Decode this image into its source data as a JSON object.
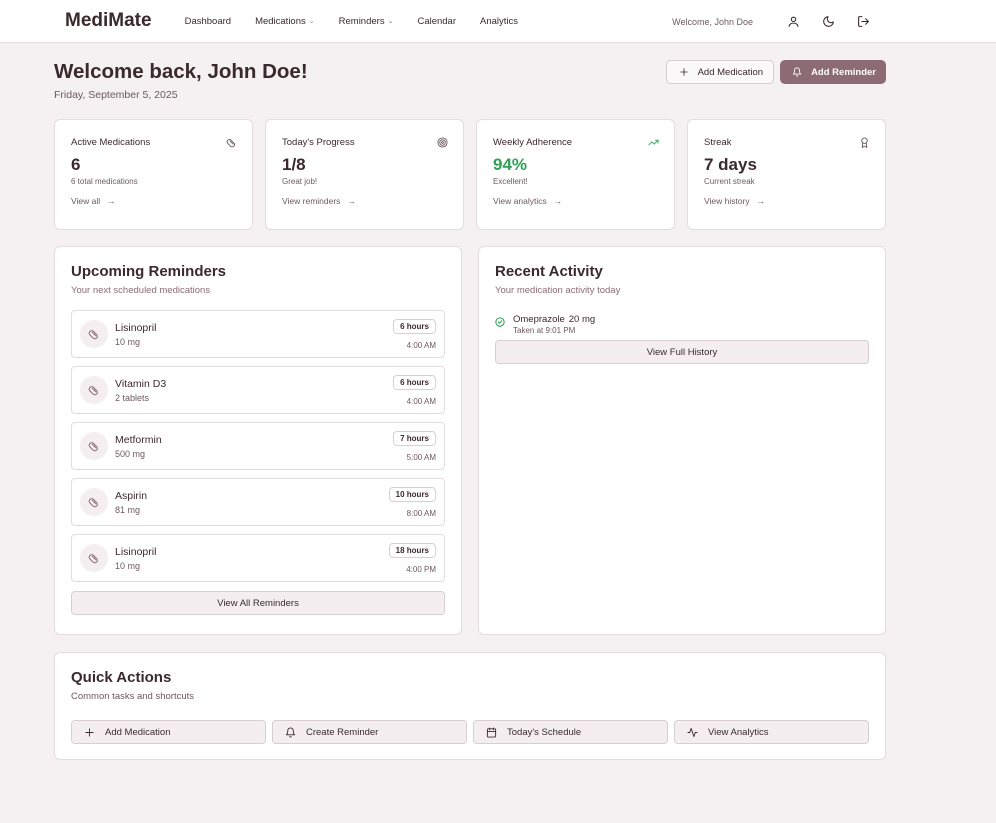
{
  "brand": "MediMate",
  "nav": [
    {
      "label": "Dashboard"
    },
    {
      "label": "Medications"
    },
    {
      "label": "Reminders"
    },
    {
      "label": "Calendar"
    },
    {
      "label": "Analytics"
    }
  ],
  "user": {
    "welcome": "Welcome, John Doe"
  },
  "header": {
    "title": "Welcome back, John Doe!",
    "date": "Friday, September 5, 2025",
    "add_medication": "Add Medication",
    "add_reminder": "Add Reminder"
  },
  "stats": [
    {
      "label": "Active Medications",
      "value": "6",
      "sub": "6 total medications",
      "link": "View all",
      "icon": "pill-icon"
    },
    {
      "label": "Today's Progress",
      "value": "1/8",
      "sub": "Great job!",
      "link": "View reminders",
      "icon": "target-icon"
    },
    {
      "label": "Weekly Adherence",
      "value": "94%",
      "sub": "Excellent!",
      "link": "View analytics",
      "icon": "trending-up-icon"
    },
    {
      "label": "Streak",
      "value": "7 days",
      "sub": "Current streak",
      "link": "View history",
      "icon": "award-icon"
    }
  ],
  "upcoming": {
    "title": "Upcoming Reminders",
    "subtitle": "Your next scheduled medications",
    "items": [
      {
        "name": "Lisinopril",
        "dose": "10 mg",
        "badge": "6 hours",
        "time": "4:00 AM"
      },
      {
        "name": "Vitamin D3",
        "dose": "2 tablets",
        "badge": "6 hours",
        "time": "4:00 AM"
      },
      {
        "name": "Metformin",
        "dose": "500 mg",
        "badge": "7 hours",
        "time": "5:00 AM"
      },
      {
        "name": "Aspirin",
        "dose": "81 mg",
        "badge": "10 hours",
        "time": "8:00 AM"
      },
      {
        "name": "Lisinopril",
        "dose": "10 mg",
        "badge": "18 hours",
        "time": "4:00 PM"
      }
    ],
    "button": "View All Reminders"
  },
  "activity": {
    "title": "Recent Activity",
    "subtitle": "Your medication activity today",
    "items": [
      {
        "name": "Omeprazole",
        "dose": "20 mg",
        "time": "Taken at 9:01 PM"
      }
    ],
    "button": "View Full History"
  },
  "quick": {
    "title": "Quick Actions",
    "subtitle": "Common tasks and shortcuts",
    "buttons": [
      {
        "label": "Add Medication",
        "icon": "plus-icon"
      },
      {
        "label": "Create Reminder",
        "icon": "bell-icon"
      },
      {
        "label": "Today's Schedule",
        "icon": "calendar-icon"
      },
      {
        "label": "View Analytics",
        "icon": "activity-icon"
      }
    ]
  },
  "colors": {
    "accent": "#8c6b75",
    "success": "#2fa157",
    "background": "#f5f0f1"
  }
}
